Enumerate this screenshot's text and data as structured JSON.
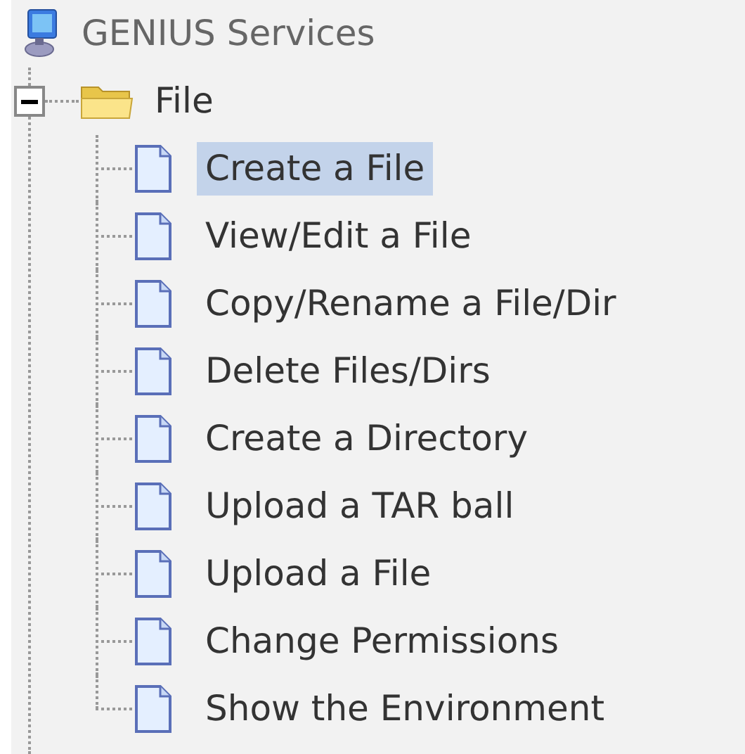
{
  "tree": {
    "label": "GENIUS Services",
    "children": [
      {
        "label": "File",
        "expanded": true,
        "children": [
          {
            "label": "Create a File",
            "selected": true
          },
          {
            "label": "View/Edit a File",
            "selected": false
          },
          {
            "label": "Copy/Rename a File/Dir",
            "selected": false
          },
          {
            "label": "Delete Files/Dirs",
            "selected": false
          },
          {
            "label": "Create a Directory",
            "selected": false
          },
          {
            "label": "Upload a TAR ball",
            "selected": false
          },
          {
            "label": "Upload a File",
            "selected": false
          },
          {
            "label": "Change Permissions",
            "selected": false
          },
          {
            "label": "Show the Environment",
            "selected": false
          }
        ]
      }
    ]
  }
}
